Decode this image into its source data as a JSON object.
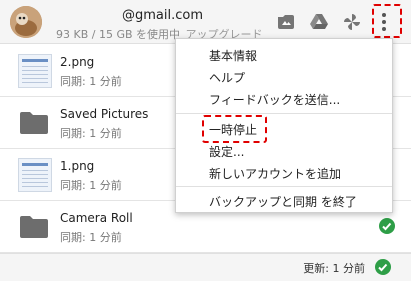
{
  "header": {
    "email": "@gmail.com",
    "storage": "93 KB / 15 GB を使用中",
    "upgrade": "アップグレード",
    "icons": [
      "photos-upload-icon",
      "google-drive-icon",
      "pinwheel-icon",
      "more-vert-icon"
    ]
  },
  "files": [
    {
      "name": "2.png",
      "status": "同期: 1 分前",
      "type": "image"
    },
    {
      "name": "Saved Pictures",
      "status": "同期: 1 分前",
      "type": "folder"
    },
    {
      "name": "1.png",
      "status": "同期: 1 分前",
      "type": "image"
    },
    {
      "name": "Camera Roll",
      "status": "同期: 1 分前",
      "type": "folder"
    }
  ],
  "footer": {
    "status": "更新: 1 分前"
  },
  "menu": {
    "items": [
      "基本情報",
      "ヘルプ",
      "フィードバックを送信...",
      "一時停止",
      "設定...",
      "新しいアカウントを追加",
      "バックアップと同期 を終了"
    ]
  },
  "colors": {
    "highlight": "#e00000",
    "sync_ok": "#2e9e47"
  }
}
